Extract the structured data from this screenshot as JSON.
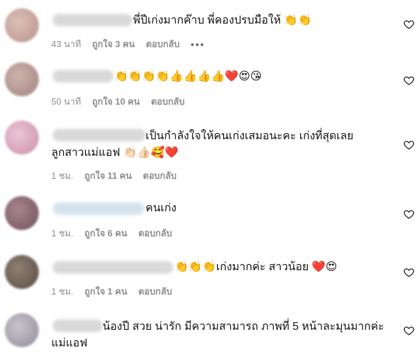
{
  "comments": [
    {
      "text": "พี่ปีเก่งมากค๊าบ พี่คองปรบมือให้ 👏👏",
      "time": "43 นาที",
      "likes": "ถูกใจ 3 คน",
      "reply": "ตอบกลับ",
      "more": "•••",
      "avatar_color": "#c9a49a"
    },
    {
      "text": "👏👏👏👏👍👍👍👍❤️😍😘",
      "time": "50 นาที",
      "likes": "ถูกใจ 10 คน",
      "reply": "ตอบกลับ",
      "avatar_color": "#b79a96"
    },
    {
      "text": "เป็นกำลังใจให้คนเก่งเสมอนะคะ เก่งที่สุดเลย ลูกสาวแม่แอฟ 👏🏻👍🏻🥰❤️",
      "time": "1 ชม.",
      "likes": "ถูกใจ 11 คน",
      "reply": "ตอบกลับ",
      "avatar_color": "#d8a7bd"
    },
    {
      "text": "คนเก่ง",
      "time": "1 ชม.",
      "likes": "ถูกใจ 6 คน",
      "reply": "ตอบกลับ",
      "avatar_color": "#8e6a74"
    },
    {
      "text": "👏👏👏เก่งมากค่ะ สาวน้อย ❤️😍",
      "time": "1 ชม.",
      "likes": "ถูกใจ 1 คน",
      "reply": "ตอบกลับ",
      "avatar_color": "#6f6155"
    },
    {
      "text": "น้องปี สวย น่ารัก มีความสามารถ ภาพที่ 5 หน้าละมุนมากค่ะ แม่แอฟ",
      "avatar_color": "#a9a4ad"
    }
  ]
}
